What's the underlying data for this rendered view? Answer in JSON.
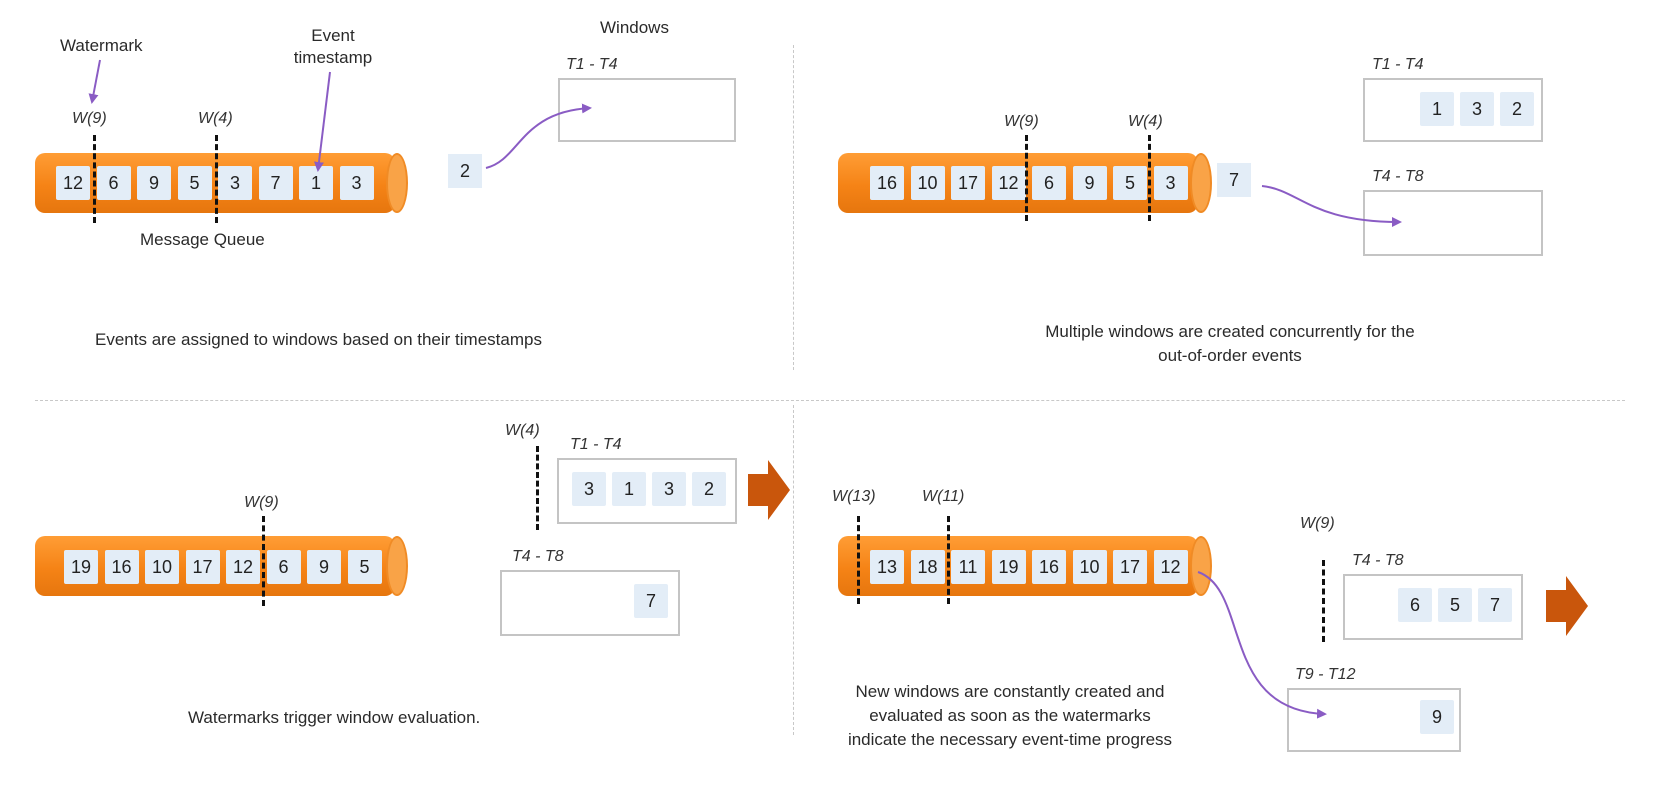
{
  "colors": {
    "pipe": "#f58316",
    "cell": "#e3edf7",
    "arrow_purple": "#8a5cc4",
    "output_arrow": "#c9560c",
    "window_border": "#c4c4c4"
  },
  "icons": {
    "output_arrow": "right-arrow-icon",
    "flow_arrow": "curved-arrow-icon"
  },
  "q1": {
    "watermark_label": "Watermark",
    "event_ts_label_1": "Event",
    "event_ts_label_2": "timestamp",
    "windows_label": "Windows",
    "wm_a": "W(9)",
    "wm_b": "W(4)",
    "queue_cells": [
      "12",
      "6",
      "9",
      "5",
      "3",
      "7",
      "1",
      "3"
    ],
    "queue_label": "Message Queue",
    "loose_event": "2",
    "window_label": "T1 - T4",
    "caption": "Events are assigned to windows based on their timestamps"
  },
  "q2": {
    "wm_a": "W(9)",
    "wm_b": "W(4)",
    "queue_cells": [
      "16",
      "10",
      "17",
      "12",
      "6",
      "9",
      "5",
      "3"
    ],
    "loose_event": "7",
    "window1_label": "T1 - T4",
    "window1_cells": [
      "1",
      "3",
      "2"
    ],
    "window2_label": "T4 - T8",
    "caption_line1": "Multiple windows are created concurrently for the",
    "caption_line2": "out-of-order events"
  },
  "q3": {
    "wm_a": "W(9)",
    "wm_window": "W(4)",
    "queue_cells": [
      "19",
      "16",
      "10",
      "17",
      "12",
      "6",
      "9",
      "5"
    ],
    "window1_label": "T1 - T4",
    "window1_cells": [
      "3",
      "1",
      "3",
      "2"
    ],
    "window2_label": "T4 - T8",
    "window2_cells": [
      "7"
    ],
    "caption": "Watermarks trigger window evaluation."
  },
  "q4": {
    "wm_a": "W(13)",
    "wm_b": "W(11)",
    "wm_window": "W(9)",
    "queue_cells": [
      "13",
      "18",
      "11",
      "19",
      "16",
      "10",
      "17",
      "12"
    ],
    "window1_label": "T4 - T8",
    "window1_cells": [
      "6",
      "5",
      "7"
    ],
    "window2_label": "T9 - T12",
    "window2_cells": [
      "9"
    ],
    "caption_line1": "New windows are constantly created and",
    "caption_line2": "evaluated as soon as the watermarks",
    "caption_line3": "indicate the necessary event-time progress"
  }
}
